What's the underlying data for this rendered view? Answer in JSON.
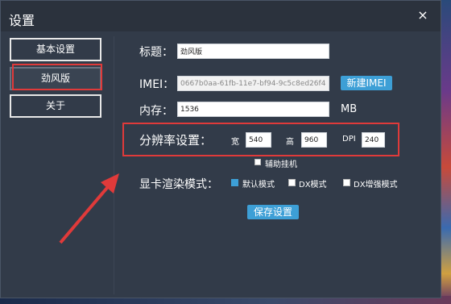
{
  "dialog": {
    "title": "设置",
    "close_label": "×"
  },
  "sidebar": {
    "items": [
      {
        "label": "基本设置"
      },
      {
        "label": "劲风版"
      },
      {
        "label": "关于"
      }
    ]
  },
  "form": {
    "title_label": "标题：",
    "title_value": "劲风版",
    "imei_label": "IMEI：",
    "imei_value": "0667b0aa-61fb-11e7-bf94-9c5c8ed26f48",
    "new_imei_button": "新建IMEI",
    "memory_label": "内存：",
    "memory_value": "1536",
    "memory_unit": "MB",
    "resolution_label": "分辨率设置：",
    "width_label": "宽",
    "width_value": "540",
    "height_label": "高",
    "height_value": "960",
    "dpi_label": "DPI",
    "dpi_value": "240",
    "assist_label": "辅助挂机",
    "render_label": "显卡渲染模式：",
    "render_options": [
      {
        "label": "默认模式",
        "checked": true
      },
      {
        "label": "DX模式",
        "checked": false
      },
      {
        "label": "DX增强模式",
        "checked": false
      }
    ],
    "save_button": "保存设置"
  },
  "colors": {
    "accent": "#3d9fd6",
    "highlight": "#e03a3a",
    "dialog_bg": "#323b49"
  }
}
